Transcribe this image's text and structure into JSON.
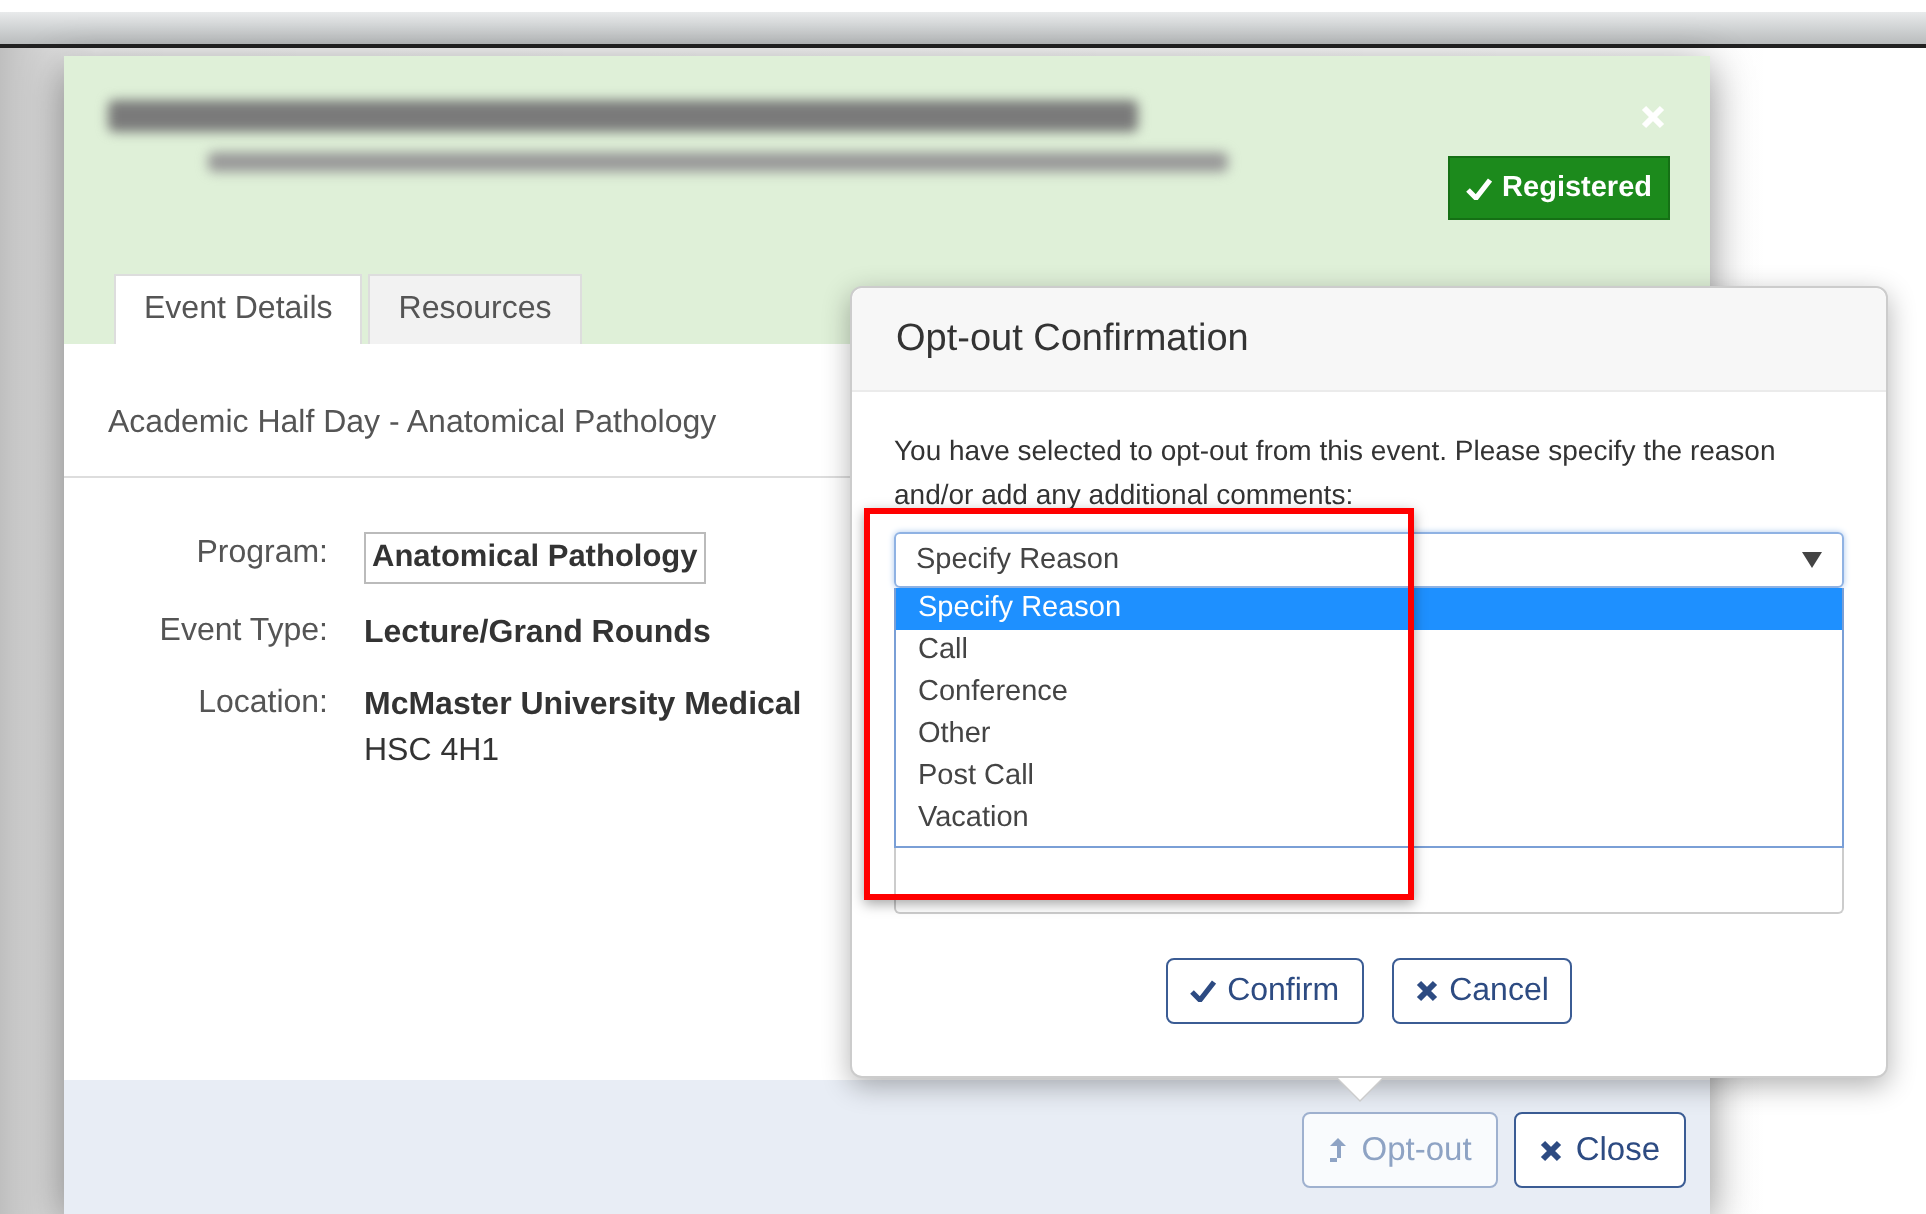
{
  "header": {
    "status_badge": "Registered"
  },
  "tabs": [
    {
      "label": "Event Details",
      "selected": true
    },
    {
      "label": "Resources",
      "selected": false
    }
  ],
  "description": "Academic Half Day - Anatomical Pathology",
  "fields": [
    {
      "label": "Program:",
      "kind": "boxed",
      "lines": [
        "Anatomical Pathology"
      ]
    },
    {
      "label": "Event Type:",
      "kind": "bold",
      "lines": [
        "Lecture/Grand Rounds"
      ]
    },
    {
      "label": "Location:",
      "kind": "bold",
      "lines": [
        "McMaster University Medical",
        "HSC 4H1"
      ]
    }
  ],
  "popover": {
    "title": "Opt-out Confirmation",
    "message": "You have selected to opt-out from this event. Please specify the reason and/or add any additional comments:",
    "select": {
      "value": "Specify Reason",
      "expanded": true,
      "options": [
        {
          "label": "Specify Reason",
          "selected": true
        },
        {
          "label": "Call",
          "selected": false
        },
        {
          "label": "Conference",
          "selected": false
        },
        {
          "label": "Other",
          "selected": false
        },
        {
          "label": "Post Call",
          "selected": false
        },
        {
          "label": "Vacation",
          "selected": false
        }
      ]
    },
    "buttons": [
      {
        "label": "Confirm",
        "kind": "confirm"
      },
      {
        "label": "Cancel",
        "kind": "cancel"
      }
    ]
  },
  "footer_buttons": [
    {
      "label": "Opt-out",
      "kind": "opt-out",
      "pressed": true
    },
    {
      "label": "Close",
      "kind": "close",
      "pressed": false
    }
  ]
}
